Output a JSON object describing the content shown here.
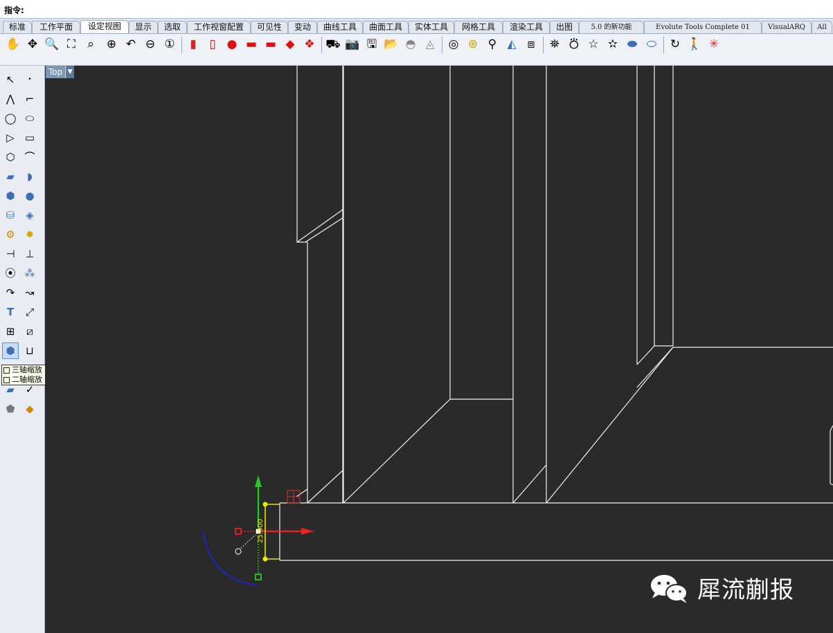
{
  "command": {
    "label": "指令:",
    "value": ""
  },
  "tabs": [
    {
      "label": "标准"
    },
    {
      "label": "工作平面"
    },
    {
      "label": "设定视图",
      "active": true
    },
    {
      "label": "显示"
    },
    {
      "label": "选取"
    },
    {
      "label": "工作视窗配置"
    },
    {
      "label": "可见性"
    },
    {
      "label": "变动"
    },
    {
      "label": "曲线工具"
    },
    {
      "label": "曲面工具"
    },
    {
      "label": "实体工具"
    },
    {
      "label": "网格工具"
    },
    {
      "label": "渲染工具"
    },
    {
      "label": "出图"
    },
    {
      "label": "5.0 的新功能"
    },
    {
      "label": "Evolute Tools Complete 01"
    },
    {
      "label": "VisualARQ"
    },
    {
      "label": "All"
    }
  ],
  "toolbar_icons": [
    "pan-icon",
    "rotate-view-icon",
    "zoom-dynamic-icon",
    "zoom-extents-icon",
    "zoom-selected-icon",
    "zoom-target-icon",
    "undo-view-icon",
    "zoom-out-icon",
    "zoom-one-to-one-icon",
    "named-view-red-icon",
    "camera-red-icon",
    "car-front-icon",
    "car-side-icon",
    "car-back-icon",
    "car-small-icon",
    "car-top-icon",
    "place-camera-icon",
    "camera-icon",
    "save-view-icon",
    "open-folder-icon",
    "light-sphere-icon",
    "spotlight-icon",
    "target-icon",
    "target-2-icon",
    "pin-icon",
    "cone-icon",
    "cube-view-icon",
    "standard-view-1-icon",
    "standard-view-2-icon",
    "star-1-icon",
    "star-2-icon",
    "disc-1-icon",
    "disc-2-icon",
    "orbit-icon",
    "walk-icon",
    "sparkle-icon"
  ],
  "viewport": {
    "name": "Top"
  },
  "tooltip": {
    "line1": "三轴缩放",
    "line2": "二轴缩放"
  },
  "widget": {
    "dimension_text": "25.000"
  },
  "watermark": {
    "text": "犀流蒯报"
  }
}
